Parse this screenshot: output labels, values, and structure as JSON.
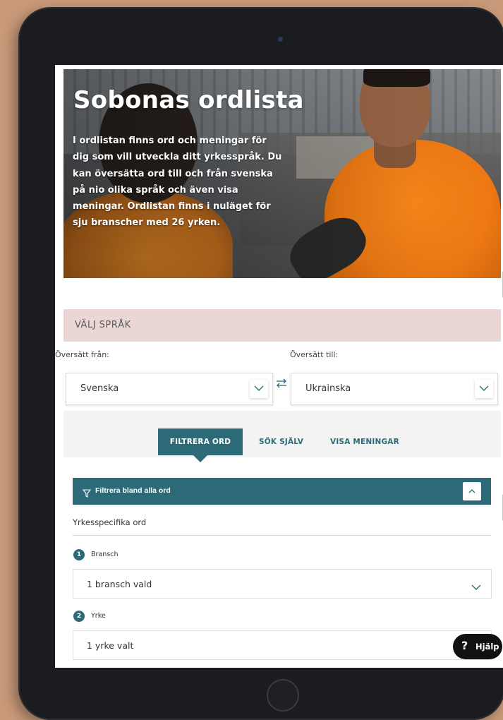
{
  "hero": {
    "title": "Sobonas ordlista",
    "description": "I ordlistan finns ord och meningar för dig som vill utveckla ditt yrkesspråk. Du kan översätta ord till och från svenska på nio olika språk och även visa meningar. Ordlistan finns i nuläget för sju branscher med 26 yrken."
  },
  "language": {
    "section_title": "VÄLJ SPRÅK",
    "from_label": "Översätt från:",
    "to_label": "Översätt till:",
    "from_value": "Svenska",
    "to_value": "Ukrainska"
  },
  "tabs": [
    {
      "label": "FILTRERA ORD",
      "active": true
    },
    {
      "label": "SÖK SJÄLV",
      "active": false
    },
    {
      "label": "VISA MENINGAR",
      "active": false
    }
  ],
  "filter": {
    "bar_label": "Filtrera bland alla ord",
    "sub_heading": "Yrkesspecifika ord",
    "steps": [
      {
        "number": "1",
        "label": "Bransch",
        "value": "1 bransch vald"
      },
      {
        "number": "2",
        "label": "Yrke",
        "value": "1 yrke valt"
      }
    ]
  },
  "help": {
    "icon": "?",
    "label": "Hjälp"
  },
  "colors": {
    "accent": "#2d6a78",
    "band": "#ead7d5",
    "background": "#c99a79"
  }
}
